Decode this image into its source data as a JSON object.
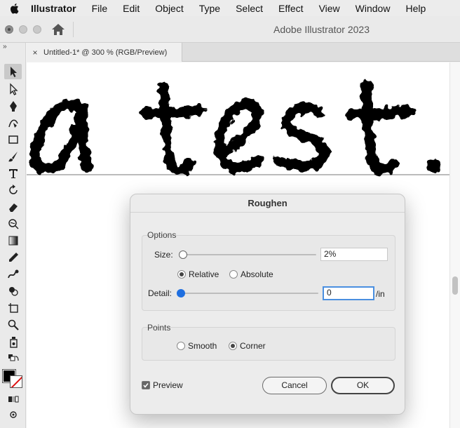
{
  "menubar": {
    "app_name": "Illustrator",
    "items": [
      "File",
      "Edit",
      "Object",
      "Type",
      "Select",
      "Effect",
      "View",
      "Window",
      "Help"
    ]
  },
  "titlebar": {
    "title": "Adobe Illustrator 2023"
  },
  "document_tab": {
    "close": "×",
    "label": "Untitled-1* @ 300 % (RGB/Preview)"
  },
  "canvas": {
    "artwork_text": "a test."
  },
  "toolbar": {
    "tools": [
      "selection-tool",
      "direct-selection-tool",
      "pen-tool",
      "curvature-tool",
      "rectangle-tool",
      "paintbrush-tool",
      "type-tool",
      "rotate-tool",
      "eraser-tool",
      "warp-tool",
      "gradient-tool",
      "eyedropper-tool",
      "blend-tool",
      "shape-builder-tool",
      "artboard-tool",
      "zoom-tool",
      "symbol-sprayer-tool"
    ],
    "active": "selection-tool"
  },
  "dialog": {
    "title": "Roughen",
    "options": {
      "group_label": "Options",
      "size_label": "Size:",
      "size_value": "2%",
      "size_slider_fraction": 0.0,
      "relative_label": "Relative",
      "absolute_label": "Absolute",
      "selected": "Relative",
      "detail_label": "Detail:",
      "detail_value": "0",
      "detail_slider_fraction": 0.0,
      "detail_unit": "/in"
    },
    "points": {
      "group_label": "Points",
      "smooth_label": "Smooth",
      "corner_label": "Corner",
      "selected": "Corner"
    },
    "preview_label": "Preview",
    "preview_checked": true,
    "cancel_label": "Cancel",
    "ok_label": "OK"
  },
  "colors": {
    "accent": "#1f6fe0",
    "fill": "#000000",
    "stroke": "none"
  }
}
